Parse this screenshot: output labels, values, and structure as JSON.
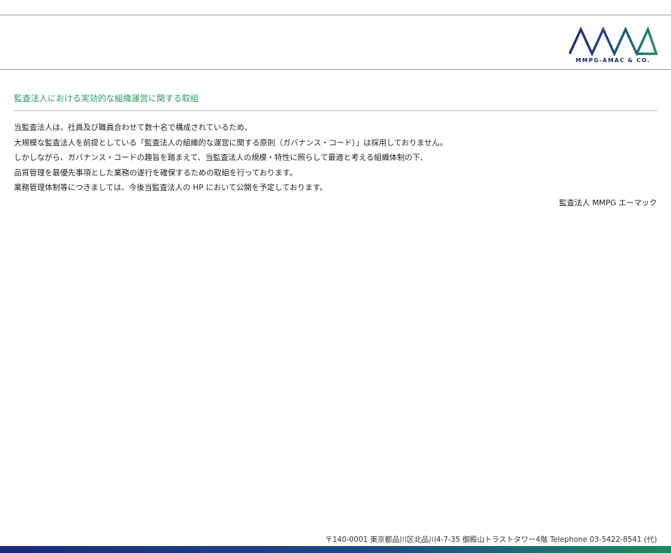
{
  "header": {
    "logo_name": "MMPG-AMAC & CO."
  },
  "section": {
    "title": "監査法人における実効的な組織運営に関する取組"
  },
  "body": {
    "lines": [
      "当監査法人は、社員及び職員合わせて数十名で構成されているため、",
      "大規模な監査法人を前提としている「監査法人の組織的な運営に関する原則（ガバナンス・コード）」は採用しておりません。",
      "しかしながら、ガバナンス・コードの趣旨を踏まえて、当監査法人の規模・特性に照らして最適と考える組織体制の下、",
      "品質管理を最優先事項とした業務の遂行を確保するための取組を行っております。",
      "業務管理体制等につきましては、今後当監査法人の HP において公開を予定しております。"
    ]
  },
  "signature": "監査法人 MMPG エーマック",
  "footer": {
    "address": "〒140-0001 東京都品川区北品川4-7-35 御殿山トラストタワー4階  Telephone 03-5422-8541 (代)"
  },
  "colors": {
    "title_green": "#2a9a62",
    "logo_navy": "#1d2a6b",
    "logo_green": "#1f8a5e"
  }
}
